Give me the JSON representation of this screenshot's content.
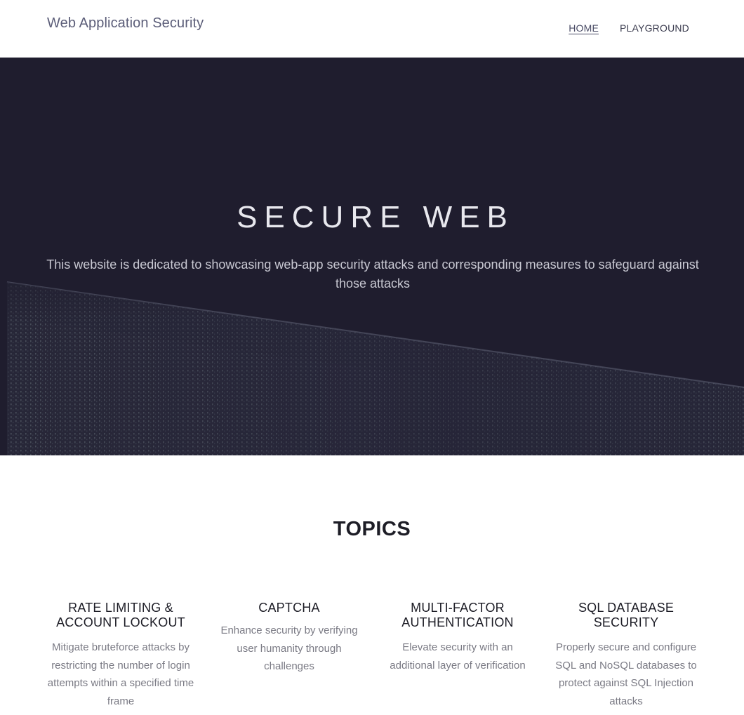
{
  "header": {
    "brand": "Web Application Security",
    "nav": [
      {
        "label": "HOME",
        "active": true
      },
      {
        "label": "PLAYGROUND",
        "active": false
      }
    ]
  },
  "hero": {
    "title": "SECURE WEB",
    "subtitle": "This website is dedicated to showcasing web-app security attacks and corresponding measures to safeguard against those attacks"
  },
  "topics": {
    "heading": "TOPICS",
    "items": [
      {
        "title": "RATE LIMITING & ACCOUNT LOCKOUT",
        "description": "Mitigate bruteforce attacks by restricting the number of login attempts within a specified time frame"
      },
      {
        "title": "CAPTCHA",
        "description": "Enhance security by verifying user humanity through challenges"
      },
      {
        "title": "MULTI-FACTOR AUTHENTICATION",
        "description": "Elevate security with an additional layer of verification"
      },
      {
        "title": "SQL DATABASE SECURITY",
        "description": "Properly secure and configure SQL and NoSQL databases to protect against SQL Injection attacks"
      }
    ]
  },
  "colors": {
    "hero_bg": "#1f1d2e",
    "brand_text": "#5b5d78",
    "heading_text": "#1d1d26",
    "body_text": "#7a7a84"
  }
}
